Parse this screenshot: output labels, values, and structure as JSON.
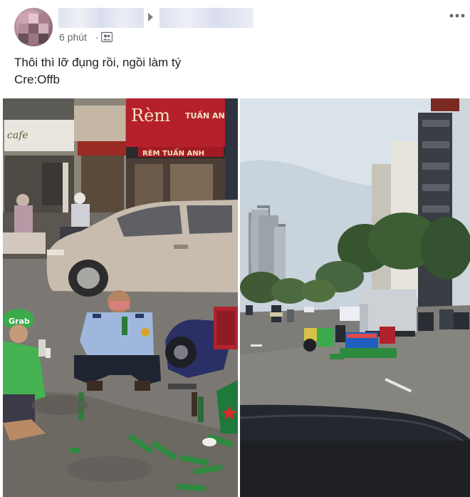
{
  "post": {
    "timestamp": "6 phút",
    "separator": "·",
    "audience_icon": "group-icon",
    "more_icon": "more-horizontal-icon",
    "text_lines": [
      "Thôi thì lỡ đụng rồi, ngồi làm tý",
      "Cre:Offb"
    ]
  },
  "photos": {
    "left": {
      "shop_sign_main": "Rèm",
      "shop_sign_sub": "TUẤN ANH",
      "shop_sign_lower": "RÈM TUẤN ANH",
      "shop_sign_left": "cafe",
      "helmet_text": "Grab"
    },
    "right": {}
  },
  "colors": {
    "secondary_text": "#606770",
    "primary_text": "#1c1e21",
    "grab_green": "#3aaa4a",
    "shop_red": "#b5202b"
  }
}
